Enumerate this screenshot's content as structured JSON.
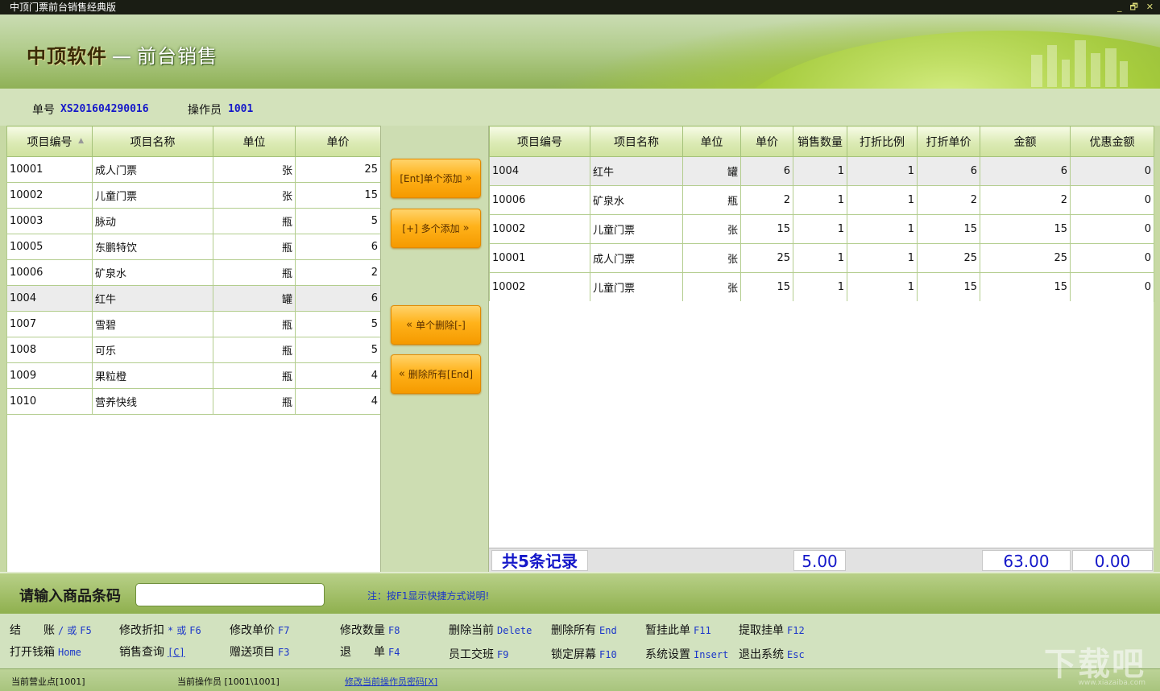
{
  "window": {
    "title": "中顶门票前台销售经典版",
    "controls": [
      "_",
      "🗗",
      "✕"
    ]
  },
  "brand": {
    "name": "中顶软件",
    "separator": "—",
    "subtitle": "前台销售"
  },
  "info": {
    "order_label": "单号",
    "order_no": "XS201604290016",
    "operator_label": "操作员",
    "operator_id": "1001"
  },
  "product_table": {
    "headers": [
      "项目编号",
      "项目名称",
      "单位",
      "单价"
    ],
    "rows": [
      [
        "10001",
        "成人门票",
        "张",
        "25"
      ],
      [
        "10002",
        "儿童门票",
        "张",
        "15"
      ],
      [
        "10003",
        "脉动",
        "瓶",
        "5"
      ],
      [
        "10005",
        "东鹏特饮",
        "瓶",
        "6"
      ],
      [
        "10006",
        "矿泉水",
        "瓶",
        "2"
      ],
      [
        "1004",
        "红牛",
        "罐",
        "6"
      ],
      [
        "1007",
        "雪碧",
        "瓶",
        "5"
      ],
      [
        "1008",
        "可乐",
        "瓶",
        "5"
      ],
      [
        "1009",
        "果粒橙",
        "瓶",
        "4"
      ],
      [
        "1010",
        "营养快线",
        "瓶",
        "4"
      ]
    ],
    "selected_index": 5
  },
  "buttons": {
    "add_single": "[Ent]单个添加",
    "add_multi": "[+] 多个添加",
    "delete_single": "单个删除[-]",
    "delete_all": "删除所有[End]",
    "arrow_right": "»",
    "arrow_left": "«"
  },
  "cart_table": {
    "headers": [
      "项目编号",
      "项目名称",
      "单位",
      "单价",
      "销售数量",
      "打折比例",
      "打折单价",
      "金额",
      "优惠金额"
    ],
    "rows": [
      [
        "1004",
        "红牛",
        "罐",
        "6",
        "1",
        "1",
        "6",
        "6",
        "0"
      ],
      [
        "10006",
        "矿泉水",
        "瓶",
        "2",
        "1",
        "1",
        "2",
        "2",
        "0"
      ],
      [
        "10002",
        "儿童门票",
        "张",
        "15",
        "1",
        "1",
        "15",
        "15",
        "0"
      ],
      [
        "10001",
        "成人门票",
        "张",
        "25",
        "1",
        "1",
        "25",
        "25",
        "0"
      ],
      [
        "10002",
        "儿童门票",
        "张",
        "15",
        "1",
        "1",
        "15",
        "15",
        "0"
      ]
    ],
    "selected_index": 0
  },
  "summary": {
    "records": "共5条记录",
    "total_qty": "5.00",
    "total_amount": "63.00",
    "total_discount": "0.00"
  },
  "barcode": {
    "label": "请输入商品条码",
    "value": "",
    "note": "注：按F1显示快捷方式说明!"
  },
  "shortcuts": {
    "row1": [
      {
        "label": "结　　账",
        "sep": "/",
        "alt": "或",
        "key": "F5"
      },
      {
        "label": "修改折扣",
        "sep": "*",
        "alt": "或",
        "key": "F6"
      },
      {
        "label": "修改单价",
        "key": "F7"
      },
      {
        "label": "修改数量",
        "key": "F8"
      },
      {
        "label": "删除当前",
        "key": "Delete"
      },
      {
        "label": "删除所有",
        "key": "End"
      },
      {
        "label": "暂挂此单",
        "key": "F11"
      },
      {
        "label": "提取挂单",
        "key": "F12"
      }
    ],
    "row2": [
      {
        "label": "打开钱箱",
        "key": "Home"
      },
      {
        "label": "销售查询",
        "key": "[C]"
      },
      {
        "label": "赠送项目",
        "key": "F3"
      },
      {
        "label": "退　　单",
        "key": "F4"
      },
      {
        "label": "员工交班",
        "key": "F9"
      },
      {
        "label": "锁定屏幕",
        "key": "F10"
      },
      {
        "label": "系统设置",
        "key": "Insert"
      },
      {
        "label": "退出系统",
        "key": "Esc"
      }
    ]
  },
  "status": {
    "sales_point": "当前营业点[1001]",
    "current_operator": "当前操作员 [1001\\1001]",
    "change_password": "修改当前操作员密码[X]"
  },
  "watermark": {
    "main": "下载吧",
    "sub": "www.xiazaiba.com"
  },
  "colors": {
    "accent_blue": "#1518c9",
    "button_orange": "#ffb21a",
    "panel_green": "#d2e2bf",
    "titlebar": "#1a1d14"
  }
}
